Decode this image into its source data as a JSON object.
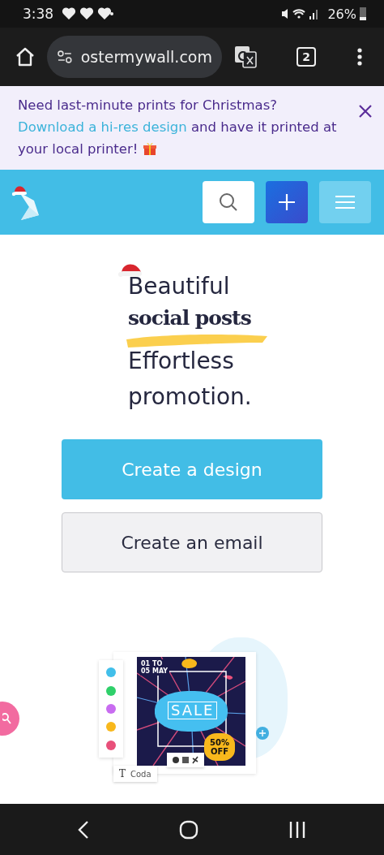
{
  "status_bar": {
    "time": "3:38",
    "battery": "26%"
  },
  "browser": {
    "url": "ostermywall.com",
    "tab_count": "2"
  },
  "banner": {
    "text_before": "Need last-minute prints for Christmas? ",
    "link": "Download a hi-res design",
    "text_after": " and have it printed at your local printer!"
  },
  "hero": {
    "line_1": "Beautiful",
    "highlight": "social posts",
    "line_3": "Effortless",
    "line_4": "promotion."
  },
  "buttons": [
    {
      "label": "Create a design",
      "kind": "primary"
    },
    {
      "label": "Create an email",
      "kind": "secondary"
    }
  ],
  "preview": {
    "swatches": [
      {
        "color": "#41bfea"
      },
      {
        "color": "#2fd06a"
      },
      {
        "color": "#c86cf0"
      },
      {
        "color": "#f8b81c"
      },
      {
        "color": "#e8507a"
      }
    ],
    "date": "01 TO 05 MAY",
    "title": "SALE",
    "badge": "50% OFF",
    "text_tool": "T",
    "font": "Coda"
  }
}
